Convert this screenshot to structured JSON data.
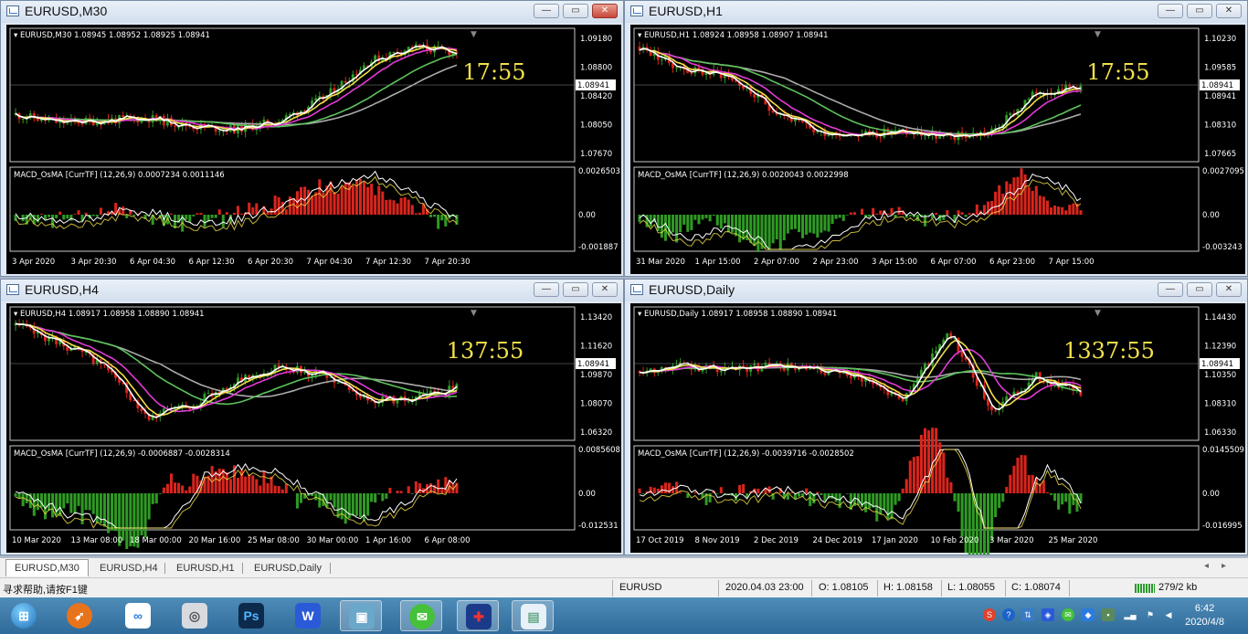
{
  "windows": [
    {
      "title": "EURUSD,M30",
      "seed": 11,
      "ticker": "EURUSD,M30  1.08945 1.08952 1.08925 1.08941",
      "price_labels": [
        "1.09180",
        "1.08800",
        "1.08420",
        "1.08050",
        "1.07670"
      ],
      "current_price": "1.08941",
      "timer": "17:55",
      "osc_label": "MACD_OsMA [CurrTF] (12,26,9) 0.0007234 0.0011146",
      "osc_labels": [
        "0.0026503",
        "0.00",
        "-0.001887"
      ],
      "time_labels": [
        "3 Apr 2020",
        "3 Apr 20:30",
        "6 Apr 04:30",
        "6 Apr 12:30",
        "6 Apr 20:30",
        "7 Apr 04:30",
        "7 Apr 12:30",
        "7 Apr 20:30"
      ],
      "trend": [
        0.35,
        0.28,
        0.3,
        0.32,
        0.25,
        0.22,
        0.3,
        0.5,
        0.82,
        0.95,
        0.9
      ]
    },
    {
      "title": "EURUSD,H1",
      "seed": 23,
      "ticker": "EURUSD,H1  1.08924 1.08958 1.08907 1.08941",
      "price_labels": [
        "1.10230",
        "1.09585",
        "1.08941",
        "1.08310",
        "1.07665"
      ],
      "current_price": "1.08941",
      "timer": "17:55",
      "osc_label": "MACD_OsMA [CurrTF] (12,26,9) 0.0020043 0.0022998",
      "osc_labels": [
        "0.0027095",
        "0.00",
        "-0.003243"
      ],
      "time_labels": [
        "31 Mar 2020",
        "1 Apr 15:00",
        "2 Apr 07:00",
        "2 Apr 23:00",
        "3 Apr 15:00",
        "6 Apr 07:00",
        "6 Apr 23:00",
        "7 Apr 15:00"
      ],
      "trend": [
        0.95,
        0.75,
        0.7,
        0.4,
        0.2,
        0.18,
        0.2,
        0.15,
        0.2,
        0.55,
        0.6
      ]
    },
    {
      "title": "EURUSD,H4",
      "seed": 37,
      "ticker": "EURUSD,H4  1.08917 1.08958 1.08890 1.08941",
      "price_labels": [
        "1.13420",
        "1.11620",
        "1.09870",
        "1.08070",
        "1.06320"
      ],
      "current_price": "1.08941",
      "timer": "137:55",
      "osc_label": "MACD_OsMA [CurrTF] (12,26,9) -0.0006887 -0.0028314",
      "osc_labels": [
        "0.0085608",
        "0.00",
        "-0.012531"
      ],
      "time_labels": [
        "10 Mar 2020",
        "13 Mar 08:00",
        "18 Mar 00:00",
        "20 Mar 16:00",
        "25 Mar 08:00",
        "30 Mar 00:00",
        "1 Apr 16:00",
        "6 Apr 08:00"
      ],
      "trend": [
        0.95,
        0.8,
        0.6,
        0.15,
        0.25,
        0.45,
        0.6,
        0.5,
        0.3,
        0.3,
        0.4
      ]
    },
    {
      "title": "EURUSD,Daily",
      "seed": 53,
      "ticker": "EURUSD,Daily  1.08917 1.08958 1.08890 1.08941",
      "price_labels": [
        "1.14430",
        "1.12390",
        "1.10350",
        "1.08310",
        "1.06330"
      ],
      "current_price": "1.08941",
      "timer": "1337:55",
      "osc_label": "MACD_OsMA [CurrTF] (12,26,9) -0.0039716 -0.0028502",
      "osc_labels": [
        "0.0145509",
        "0.00",
        "-0.016995"
      ],
      "time_labels": [
        "17 Oct 2019",
        "8 Nov 2019",
        "2 Dec 2019",
        "24 Dec 2019",
        "17 Jan 2020",
        "10 Feb 2020",
        "3 Mar 2020",
        "25 Mar 2020"
      ],
      "trend": [
        0.55,
        0.6,
        0.55,
        0.6,
        0.55,
        0.5,
        0.3,
        0.9,
        0.2,
        0.5,
        0.35
      ]
    }
  ],
  "tabs": [
    "EURUSD,M30",
    "EURUSD,H4",
    "EURUSD,H1",
    "EURUSD,Daily"
  ],
  "status": {
    "help": "寻求帮助,请按F1键",
    "symbol": "EURUSD",
    "datetime": "2020.04.03 23:00",
    "open": "O: 1.08105",
    "high": "H: 1.08158",
    "low": "L: 1.08055",
    "close": "C: 1.08074",
    "traffic": "279/2 kb"
  },
  "clock": {
    "time": "6:42",
    "date": "2020/4/8"
  },
  "colors": {
    "bull": "#2f9a24",
    "bear": "#d9251d",
    "ma_fast": "#ffffff",
    "ma_yellow": "#f2e04a",
    "ma_magenta": "#e23ad6",
    "ma_green": "#5cc25c",
    "ma_gray": "#aaaaaa",
    "timer": "#f2e04a"
  }
}
